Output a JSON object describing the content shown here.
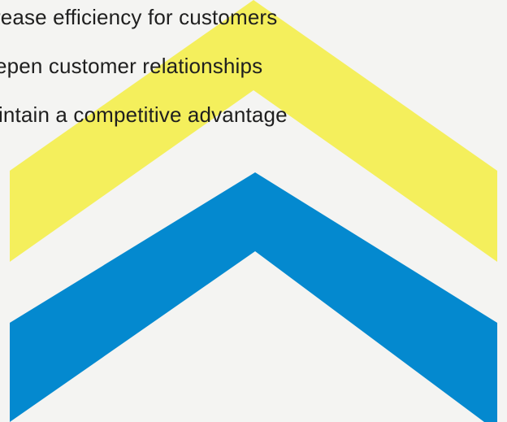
{
  "bullets": [
    "rease efficiency for customers",
    "epen customer relationships",
    "intain a competitive advantage"
  ],
  "colors": {
    "background": "#f4f4f2",
    "yellow_chevron": "#f4ef5c",
    "blue_chevron": "#0489cf",
    "text": "#1f1f1f"
  },
  "icons": [
    "yellow-chevron-up-icon",
    "blue-chevron-up-icon"
  ]
}
